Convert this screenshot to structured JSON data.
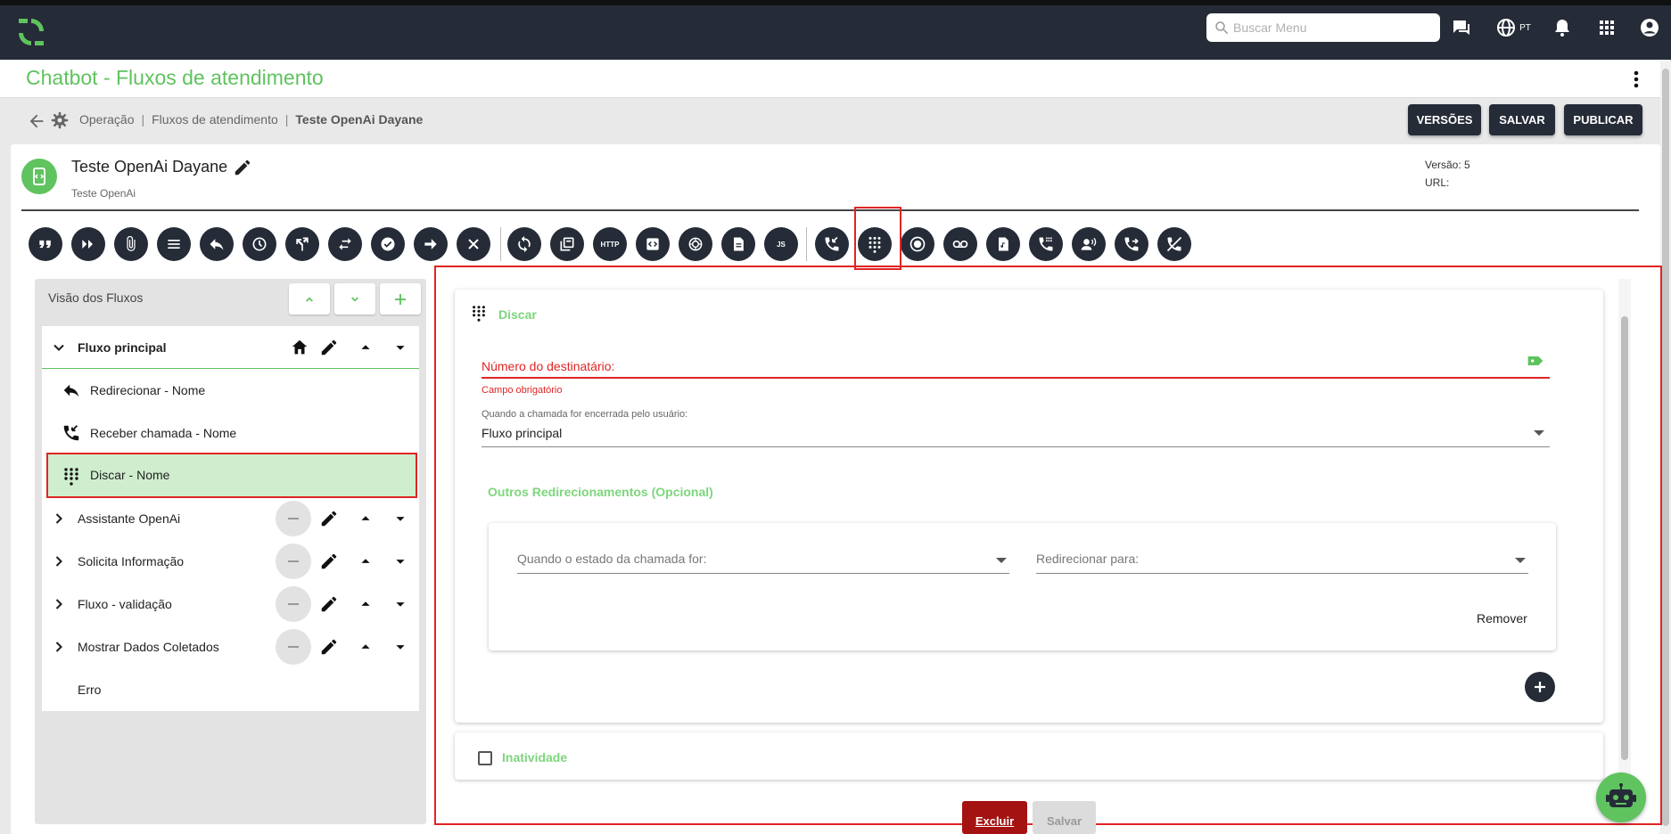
{
  "header": {
    "search_placeholder": "Buscar Menu",
    "lang": "PT"
  },
  "page": {
    "title": "Chatbot - Fluxos de atendimento"
  },
  "breadcrumb": {
    "items": [
      "Operação",
      "Fluxos de atendimento"
    ],
    "current": "Teste OpenAi Dayane",
    "separator": "|"
  },
  "actions": {
    "versions": "VERSÕES",
    "save": "SALVAR",
    "publish": "PUBLICAR"
  },
  "flow": {
    "name": "Teste OpenAi Dayane",
    "subtitle": "Teste OpenAi",
    "version_label": "Versão: 5",
    "url_label": "URL:"
  },
  "toolbar": {
    "tools": [
      {
        "icon": "quote-icon"
      },
      {
        "icon": "double-chevron-icon"
      },
      {
        "icon": "attachment-icon"
      },
      {
        "icon": "menu-lines-icon"
      },
      {
        "icon": "reply-icon"
      },
      {
        "icon": "clock-icon"
      },
      {
        "icon": "branch-icon"
      },
      {
        "icon": "swap-icon"
      },
      {
        "icon": "check-circle-icon"
      },
      {
        "icon": "arrow-right-icon"
      },
      {
        "icon": "close-icon"
      },
      {
        "icon": "sync-icon"
      },
      {
        "icon": "copy-icon"
      },
      {
        "icon": "http-icon",
        "text": "HTTP"
      },
      {
        "icon": "code-icon"
      },
      {
        "icon": "openai-icon"
      },
      {
        "icon": "document-icon"
      },
      {
        "icon": "js-icon",
        "text": "JS"
      },
      {
        "icon": "incoming-call-icon"
      },
      {
        "icon": "dialpad-icon"
      },
      {
        "icon": "record-icon"
      },
      {
        "icon": "voicemail-icon"
      },
      {
        "icon": "audio-file-icon"
      },
      {
        "icon": "phone-keypad-icon"
      },
      {
        "icon": "voice-user-icon"
      },
      {
        "icon": "transfer-call-icon"
      },
      {
        "icon": "hangup-icon"
      }
    ]
  },
  "panel": {
    "title": "Visão dos Fluxos",
    "main_flow": "Fluxo principal",
    "children": [
      "Redirecionar - Nome",
      "Receber chamada - Nome",
      "Discar - Nome"
    ],
    "other_flows": [
      "Assistante OpenAi",
      "Solicita Informação",
      "Fluxo - validação",
      "Mostrar Dados Coletados"
    ],
    "error_item": "Erro"
  },
  "editor": {
    "section_title": "Discar",
    "number_label": "Número do destinatário:",
    "required_error": "Campo obrigatório",
    "ended_label": "Quando a chamada for encerrada pelo usuário:",
    "ended_value": "Fluxo principal",
    "other_redirects_title": "Outros Redirecionamentos (Opcional)",
    "state_label": "Quando o estado da chamada for:",
    "redirect_label": "Redirecionar para:",
    "remove": "Remover",
    "inactivity": "Inatividade",
    "delete": "Excluir",
    "save": "Salvar"
  },
  "colors": {
    "brand_green": "#5fc35f",
    "dark": "#252b37",
    "error_red": "#e02424",
    "delete_red": "#a51212"
  }
}
